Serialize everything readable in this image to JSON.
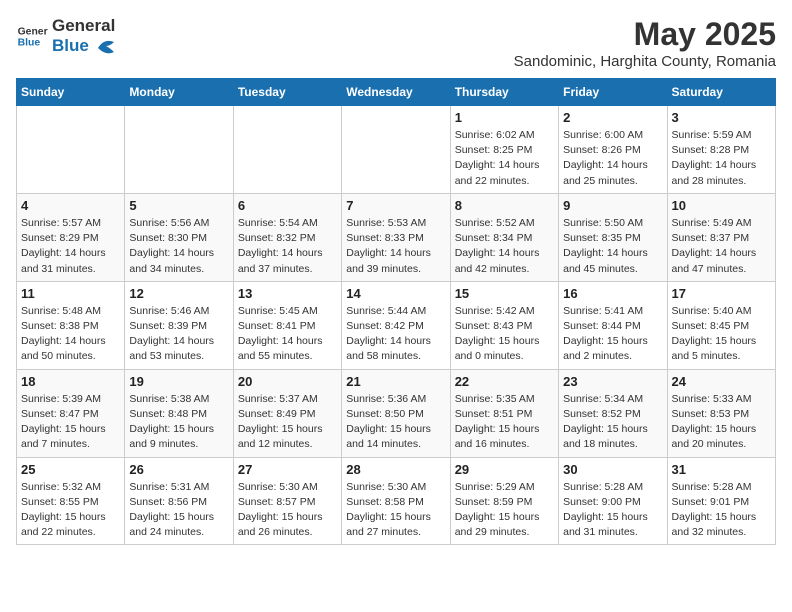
{
  "header": {
    "logo_general": "General",
    "logo_blue": "Blue",
    "title": "May 2025",
    "subtitle": "Sandominic, Harghita County, Romania"
  },
  "columns": [
    "Sunday",
    "Monday",
    "Tuesday",
    "Wednesday",
    "Thursday",
    "Friday",
    "Saturday"
  ],
  "weeks": [
    {
      "days": [
        {
          "num": "",
          "info": ""
        },
        {
          "num": "",
          "info": ""
        },
        {
          "num": "",
          "info": ""
        },
        {
          "num": "",
          "info": ""
        },
        {
          "num": "1",
          "info": "Sunrise: 6:02 AM\nSunset: 8:25 PM\nDaylight: 14 hours\nand 22 minutes."
        },
        {
          "num": "2",
          "info": "Sunrise: 6:00 AM\nSunset: 8:26 PM\nDaylight: 14 hours\nand 25 minutes."
        },
        {
          "num": "3",
          "info": "Sunrise: 5:59 AM\nSunset: 8:28 PM\nDaylight: 14 hours\nand 28 minutes."
        }
      ]
    },
    {
      "days": [
        {
          "num": "4",
          "info": "Sunrise: 5:57 AM\nSunset: 8:29 PM\nDaylight: 14 hours\nand 31 minutes."
        },
        {
          "num": "5",
          "info": "Sunrise: 5:56 AM\nSunset: 8:30 PM\nDaylight: 14 hours\nand 34 minutes."
        },
        {
          "num": "6",
          "info": "Sunrise: 5:54 AM\nSunset: 8:32 PM\nDaylight: 14 hours\nand 37 minutes."
        },
        {
          "num": "7",
          "info": "Sunrise: 5:53 AM\nSunset: 8:33 PM\nDaylight: 14 hours\nand 39 minutes."
        },
        {
          "num": "8",
          "info": "Sunrise: 5:52 AM\nSunset: 8:34 PM\nDaylight: 14 hours\nand 42 minutes."
        },
        {
          "num": "9",
          "info": "Sunrise: 5:50 AM\nSunset: 8:35 PM\nDaylight: 14 hours\nand 45 minutes."
        },
        {
          "num": "10",
          "info": "Sunrise: 5:49 AM\nSunset: 8:37 PM\nDaylight: 14 hours\nand 47 minutes."
        }
      ]
    },
    {
      "days": [
        {
          "num": "11",
          "info": "Sunrise: 5:48 AM\nSunset: 8:38 PM\nDaylight: 14 hours\nand 50 minutes."
        },
        {
          "num": "12",
          "info": "Sunrise: 5:46 AM\nSunset: 8:39 PM\nDaylight: 14 hours\nand 53 minutes."
        },
        {
          "num": "13",
          "info": "Sunrise: 5:45 AM\nSunset: 8:41 PM\nDaylight: 14 hours\nand 55 minutes."
        },
        {
          "num": "14",
          "info": "Sunrise: 5:44 AM\nSunset: 8:42 PM\nDaylight: 14 hours\nand 58 minutes."
        },
        {
          "num": "15",
          "info": "Sunrise: 5:42 AM\nSunset: 8:43 PM\nDaylight: 15 hours\nand 0 minutes."
        },
        {
          "num": "16",
          "info": "Sunrise: 5:41 AM\nSunset: 8:44 PM\nDaylight: 15 hours\nand 2 minutes."
        },
        {
          "num": "17",
          "info": "Sunrise: 5:40 AM\nSunset: 8:45 PM\nDaylight: 15 hours\nand 5 minutes."
        }
      ]
    },
    {
      "days": [
        {
          "num": "18",
          "info": "Sunrise: 5:39 AM\nSunset: 8:47 PM\nDaylight: 15 hours\nand 7 minutes."
        },
        {
          "num": "19",
          "info": "Sunrise: 5:38 AM\nSunset: 8:48 PM\nDaylight: 15 hours\nand 9 minutes."
        },
        {
          "num": "20",
          "info": "Sunrise: 5:37 AM\nSunset: 8:49 PM\nDaylight: 15 hours\nand 12 minutes."
        },
        {
          "num": "21",
          "info": "Sunrise: 5:36 AM\nSunset: 8:50 PM\nDaylight: 15 hours\nand 14 minutes."
        },
        {
          "num": "22",
          "info": "Sunrise: 5:35 AM\nSunset: 8:51 PM\nDaylight: 15 hours\nand 16 minutes."
        },
        {
          "num": "23",
          "info": "Sunrise: 5:34 AM\nSunset: 8:52 PM\nDaylight: 15 hours\nand 18 minutes."
        },
        {
          "num": "24",
          "info": "Sunrise: 5:33 AM\nSunset: 8:53 PM\nDaylight: 15 hours\nand 20 minutes."
        }
      ]
    },
    {
      "days": [
        {
          "num": "25",
          "info": "Sunrise: 5:32 AM\nSunset: 8:55 PM\nDaylight: 15 hours\nand 22 minutes."
        },
        {
          "num": "26",
          "info": "Sunrise: 5:31 AM\nSunset: 8:56 PM\nDaylight: 15 hours\nand 24 minutes."
        },
        {
          "num": "27",
          "info": "Sunrise: 5:30 AM\nSunset: 8:57 PM\nDaylight: 15 hours\nand 26 minutes."
        },
        {
          "num": "28",
          "info": "Sunrise: 5:30 AM\nSunset: 8:58 PM\nDaylight: 15 hours\nand 27 minutes."
        },
        {
          "num": "29",
          "info": "Sunrise: 5:29 AM\nSunset: 8:59 PM\nDaylight: 15 hours\nand 29 minutes."
        },
        {
          "num": "30",
          "info": "Sunrise: 5:28 AM\nSunset: 9:00 PM\nDaylight: 15 hours\nand 31 minutes."
        },
        {
          "num": "31",
          "info": "Sunrise: 5:28 AM\nSunset: 9:01 PM\nDaylight: 15 hours\nand 32 minutes."
        }
      ]
    }
  ]
}
